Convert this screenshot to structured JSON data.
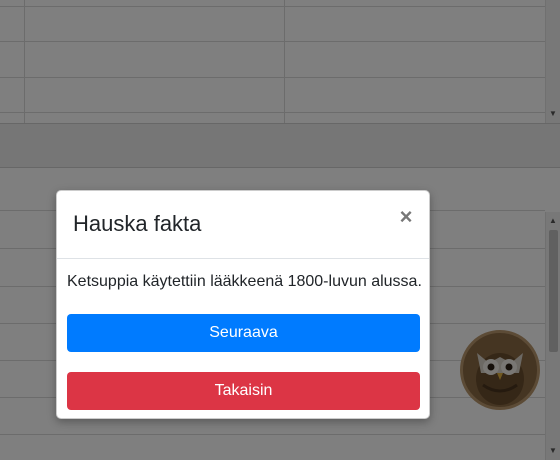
{
  "modal": {
    "title": "Hauska fakta",
    "close_glyph": "×",
    "fact_text": "Ketsuppia käytettiin lääkkeenä 1800-luvun alussa.",
    "next_label": "Seuraava",
    "back_label": "Takaisin"
  },
  "colors": {
    "primary": "#007bff",
    "danger": "#dc3545",
    "overlay": "rgba(0,0,0,0.5)"
  },
  "icons": {
    "close": "close-icon",
    "avatar": "owl-avatar",
    "scroll_up": "chevron-up-icon",
    "scroll_down": "chevron-down-icon"
  },
  "scroll_glyphs": {
    "up": "▲",
    "down": "▼"
  }
}
